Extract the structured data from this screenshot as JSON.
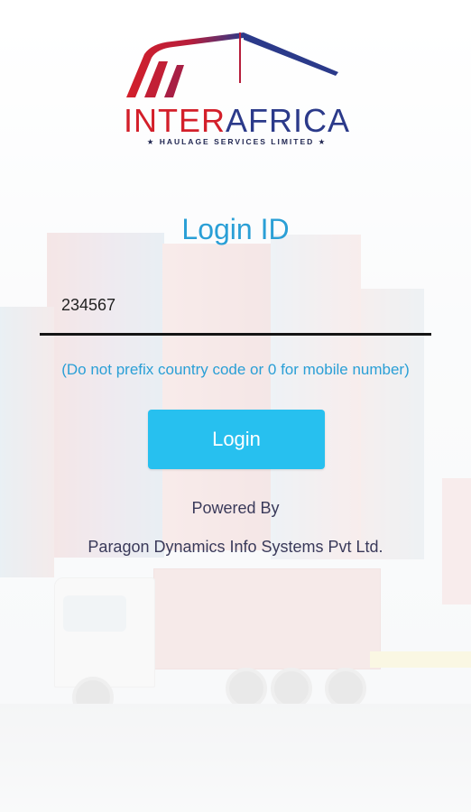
{
  "logo": {
    "brand_part1": "INTER",
    "brand_part2": "AFRICA",
    "subtitle": "★ HAULAGE SERVICES LIMITED ★",
    "colors": {
      "red": "#d31f2a",
      "blue": "#2b3a8a"
    }
  },
  "login": {
    "title": "Login ID",
    "input_value": "234567",
    "hint": "(Do not prefix country code or 0 for mobile number)",
    "button_label": "Login"
  },
  "footer": {
    "powered_by": "Powered By",
    "company": "Paragon Dynamics Info Systems Pvt Ltd."
  },
  "colors": {
    "accent": "#2a9fd6",
    "button": "#27c0ef"
  }
}
